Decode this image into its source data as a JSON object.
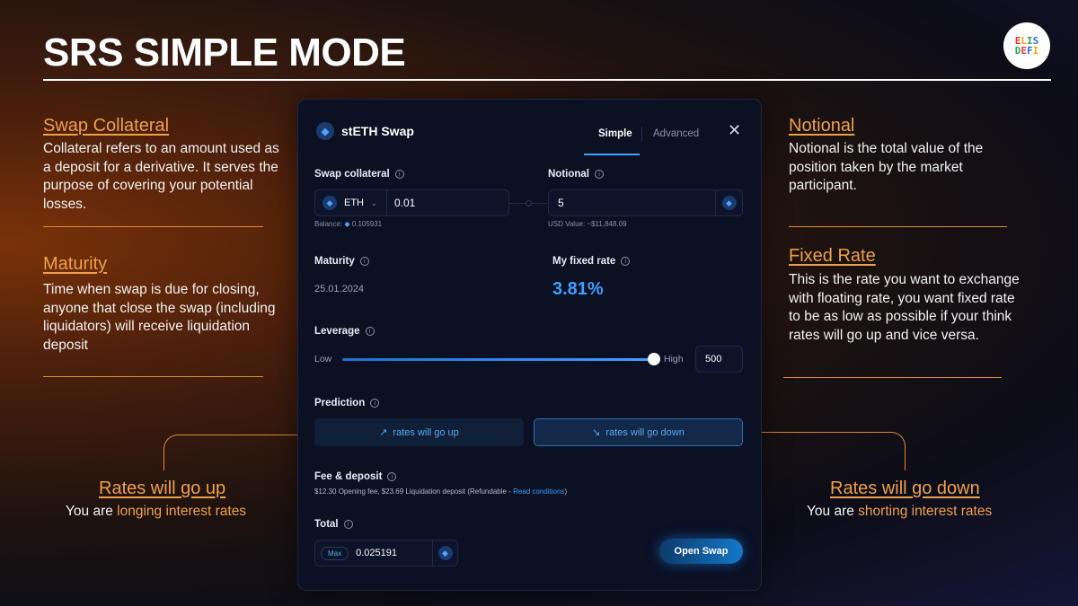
{
  "header": {
    "title": "SRS SIMPLE MODE",
    "logo_line1": "ELIS",
    "logo_line2": "DEFI"
  },
  "left": {
    "collateral": {
      "heading": "Swap Collateral",
      "text": "Collateral refers to an amount used as a deposit for a derivative. It serves the purpose of covering your potential losses."
    },
    "maturity": {
      "heading": "Maturity",
      "text": "Time when swap is due for closing, anyone that close the swap (including liquidators) will receive liquidation deposit"
    },
    "up": {
      "heading": "Rates will go up",
      "prefix": "You are ",
      "highlight": "longing interest rates"
    }
  },
  "right": {
    "notional": {
      "heading": "Notional",
      "text": "Notional is the total value of the position taken by the market participant."
    },
    "fixed": {
      "heading": "Fixed Rate",
      "text": "This is the rate you want to exchange with floating rate, you want fixed rate to be as low as possible if your think rates will go up and vice versa."
    },
    "down": {
      "heading": "Rates will go down",
      "prefix": "You are ",
      "highlight": "shorting interest rates"
    }
  },
  "panel": {
    "title": "stETH Swap",
    "tabs": {
      "simple": "Simple",
      "advanced": "Advanced"
    },
    "close": "✕",
    "collateral": {
      "label": "Swap collateral",
      "token": "ETH",
      "value": "0.01",
      "balance_label": "Balance:",
      "balance": "0.105931"
    },
    "notional": {
      "label": "Notional",
      "value": "5",
      "usd": "USD Value: ~$11,848.09"
    },
    "maturity": {
      "label": "Maturity",
      "value": "25.01.2024"
    },
    "fixed_rate": {
      "label": "My fixed rate",
      "value": "3.81%"
    },
    "leverage": {
      "label": "Leverage",
      "low": "Low",
      "high": "High",
      "value": "500",
      "level_fraction": 0.99
    },
    "prediction": {
      "label": "Prediction",
      "up": "rates will go up",
      "down": "rates will go down",
      "up_icon": "↗",
      "down_icon": "↘"
    },
    "fee": {
      "label": "Fee & deposit",
      "text": "$12.30 Opening fee, $23.69 Liquidation deposit (Refundable - ",
      "link": "Read conditions",
      "tail": ")"
    },
    "total": {
      "label": "Total",
      "max": "Max",
      "value": "0.025191"
    },
    "open_button": "Open Swap"
  },
  "colors": {
    "accent": "#3ea0ff",
    "annotation": "#f0a04a"
  }
}
